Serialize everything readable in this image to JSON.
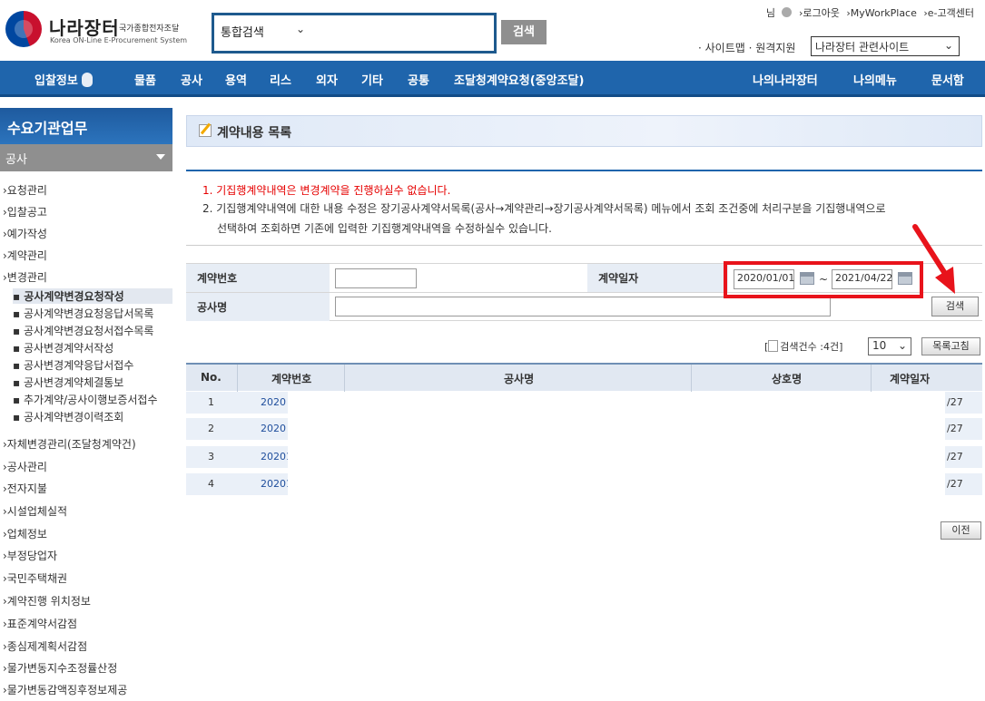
{
  "header": {
    "logo_main": "나라장터",
    "logo_small": "국가종합전자조달",
    "logo_sub": "Korea ON-Line E-Procurement System",
    "search_select": "통합검색",
    "search_button": "검색",
    "top_links": [
      "님",
      "›로그아웃",
      "›MyWorkPlace",
      "›e-고객센터"
    ],
    "sitemap": "· 사이트맵 · 원격지원",
    "related_select": "나라장터 관련사이트"
  },
  "nav": {
    "left": [
      "입찰정보",
      "물품",
      "공사",
      "용역",
      "리스",
      "외자",
      "기타",
      "공통",
      "조달청계약요청(중앙조달)"
    ],
    "right": [
      "나의나라장터",
      "나의메뉴",
      "문서함"
    ]
  },
  "sidebar": {
    "title": "수요기관업무",
    "section": "공사",
    "items_top": [
      "›요청관리",
      "›입찰공고",
      "›예가작성",
      "›계약관리",
      "›변경관리"
    ],
    "sub_items": [
      "▪ 공사계약변경요청작성",
      "▪ 공사계약변경요청응답서목록",
      "▪ 공사계약변경요청서접수목록",
      "▪ 공사변경계약서작성",
      "▪ 공사변경계약응답서접수",
      "▪ 공사변경계약체결통보",
      "▪ 추가계약/공사이행보증서접수",
      "▪ 공사계약변경이력조회"
    ],
    "items_bottom": [
      "›자체변경관리(조달청계약건)",
      "›공사관리",
      "›전자지불",
      "›시설업체실적",
      "›업체정보",
      "›부정당업자",
      "›국민주택채권",
      "›계약진행 위치정보",
      "›표준계약서감점",
      "›종심제계획서감점",
      "›물가변동지수조정률산정",
      "›물가변동감액징후정보제공"
    ]
  },
  "main": {
    "title": "계약내용 목록",
    "notice1": "1. 기집행계약내역은 변경계약을 진행하실수 없습니다.",
    "notice2": "2. 기집행계약내역에 대한 내용 수정은 장기공사계약서목록(공사→계약관리→장기공사계약서목록) 메뉴에서 조회 조건중에 처리구분을 기집행내역으로",
    "notice3": "선택하여 조회하면 기존에 입력한 기집행계약내역을 수정하실수 있습니다.",
    "form": {
      "contract_no_label": "계약번호",
      "contract_no_value": "",
      "contract_date_label": "계약일자",
      "date_from": "2020/01/01",
      "tilde": "~",
      "date_to": "2021/04/22",
      "project_label": "공사명",
      "project_value": "",
      "search_button": "검색"
    },
    "count_text": "검색건수 :4건]",
    "count_prefix": "[",
    "page_size": "10",
    "list_button": "목록고침",
    "table": {
      "headers": [
        "No.",
        "계약번호",
        "공사명",
        "상호명",
        "계약일자"
      ],
      "rows": [
        {
          "no": "1",
          "num": "2020",
          "date": "/27"
        },
        {
          "no": "2",
          "num": "2020",
          "date": "/27"
        },
        {
          "no": "3",
          "num": "20201",
          "date": "/27"
        },
        {
          "no": "4",
          "num": "20201",
          "date": "/27"
        }
      ]
    },
    "prev_button": "이전"
  },
  "colors": {
    "nav_blue": "#1f65ac",
    "highlight_red": "#e8131b",
    "notice_red": "#e60000"
  }
}
